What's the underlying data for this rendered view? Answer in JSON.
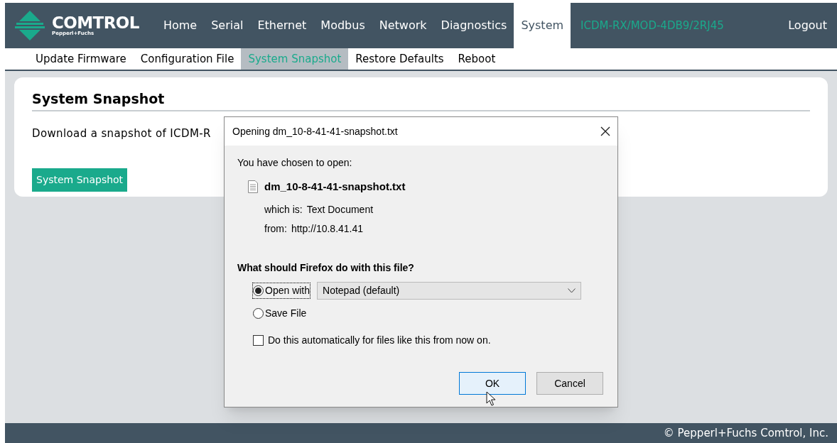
{
  "logo": {
    "name": "COMTROL",
    "subtitle": "Pepperl+Fuchs"
  },
  "nav": [
    {
      "label": "Home",
      "selected": false
    },
    {
      "label": "Serial",
      "selected": false
    },
    {
      "label": "Ethernet",
      "selected": false
    },
    {
      "label": "Modbus",
      "selected": false
    },
    {
      "label": "Network",
      "selected": false
    },
    {
      "label": "Diagnostics",
      "selected": false
    },
    {
      "label": "System",
      "selected": true
    }
  ],
  "device_name": "ICDM-RX/MOD-4DB9/2RJ45",
  "logout": "Logout",
  "subnav": [
    {
      "label": "Update Firmware",
      "selected": false
    },
    {
      "label": "Configuration File",
      "selected": false
    },
    {
      "label": "System Snapshot",
      "selected": true
    },
    {
      "label": "Restore Defaults",
      "selected": false
    },
    {
      "label": "Reboot",
      "selected": false
    }
  ],
  "card": {
    "title": "System Snapshot",
    "description": "Download a snapshot of ICDM-R",
    "button": "System Snapshot"
  },
  "dialog": {
    "title": "Opening dm_10-8-41-41-snapshot.txt",
    "intro": "You have chosen to open:",
    "file_name": "dm_10-8-41-41-snapshot.txt",
    "type_label": "which is:",
    "type_value": "Text Document",
    "from_label": "from:",
    "from_value": "http://10.8.41.41",
    "question": "What should Firefox do with this file?",
    "options": [
      {
        "label": "Open with",
        "selected": true,
        "app": "Notepad (default)"
      },
      {
        "label": "Save File",
        "selected": false
      }
    ],
    "auto": {
      "label": "Do this automatically for files like this from now on.",
      "checked": false
    },
    "buttons": [
      {
        "label": "OK",
        "focused": true
      },
      {
        "label": "Cancel",
        "focused": false
      }
    ]
  },
  "footer": "© Pepperl+Fuchs Comtrol, Inc."
}
